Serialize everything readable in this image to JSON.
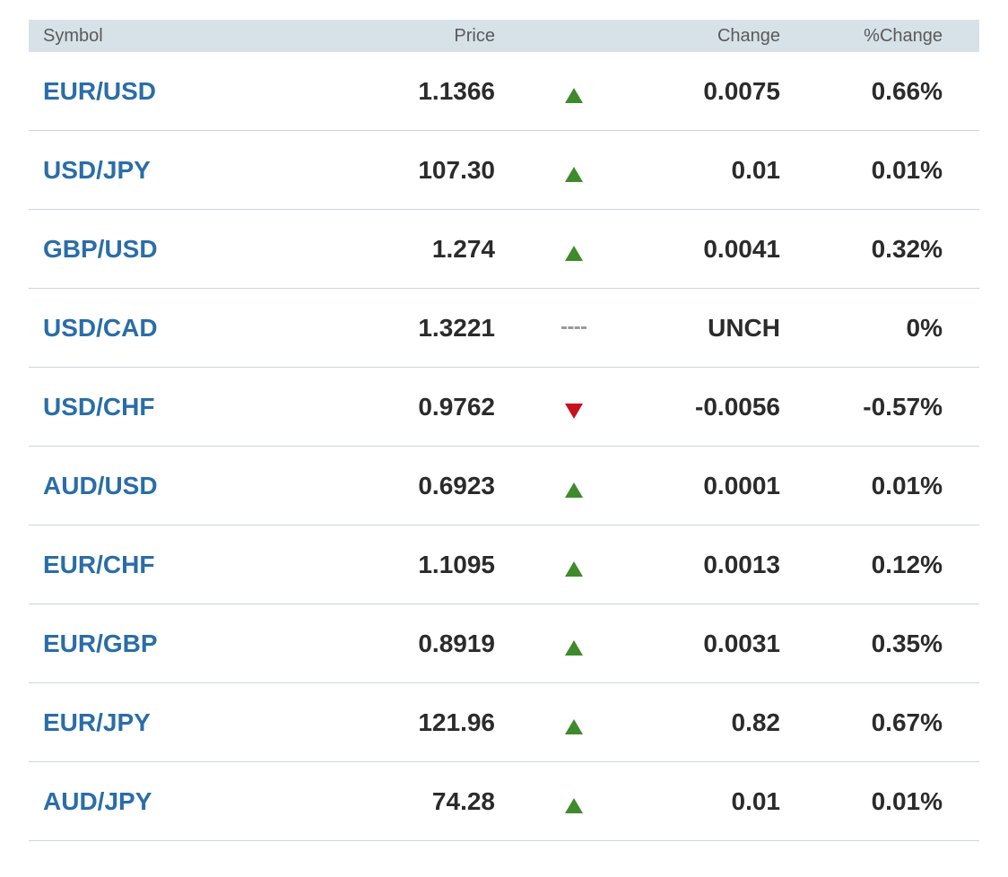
{
  "header": {
    "symbol": "Symbol",
    "price": "Price",
    "change": "Change",
    "pct_change": "%Change"
  },
  "colors": {
    "up": "#3f8a2c",
    "down": "#c8101e",
    "link": "#2a6da8",
    "header_bg": "#d7e1e8"
  },
  "rows": [
    {
      "symbol": "EUR/USD",
      "price": "1.1366",
      "direction": "up",
      "change": "0.0075",
      "pct": "0.66%"
    },
    {
      "symbol": "USD/JPY",
      "price": "107.30",
      "direction": "up",
      "change": "0.01",
      "pct": "0.01%"
    },
    {
      "symbol": "GBP/USD",
      "price": "1.274",
      "direction": "up",
      "change": "0.0041",
      "pct": "0.32%"
    },
    {
      "symbol": "USD/CAD",
      "price": "1.3221",
      "direction": "flat",
      "change": "UNCH",
      "pct": "0%"
    },
    {
      "symbol": "USD/CHF",
      "price": "0.9762",
      "direction": "down",
      "change": "-0.0056",
      "pct": "-0.57%"
    },
    {
      "symbol": "AUD/USD",
      "price": "0.6923",
      "direction": "up",
      "change": "0.0001",
      "pct": "0.01%"
    },
    {
      "symbol": "EUR/CHF",
      "price": "1.1095",
      "direction": "up",
      "change": "0.0013",
      "pct": "0.12%"
    },
    {
      "symbol": "EUR/GBP",
      "price": "0.8919",
      "direction": "up",
      "change": "0.0031",
      "pct": "0.35%"
    },
    {
      "symbol": "EUR/JPY",
      "price": "121.96",
      "direction": "up",
      "change": "0.82",
      "pct": "0.67%"
    },
    {
      "symbol": "AUD/JPY",
      "price": "74.28",
      "direction": "up",
      "change": "0.01",
      "pct": "0.01%"
    }
  ]
}
